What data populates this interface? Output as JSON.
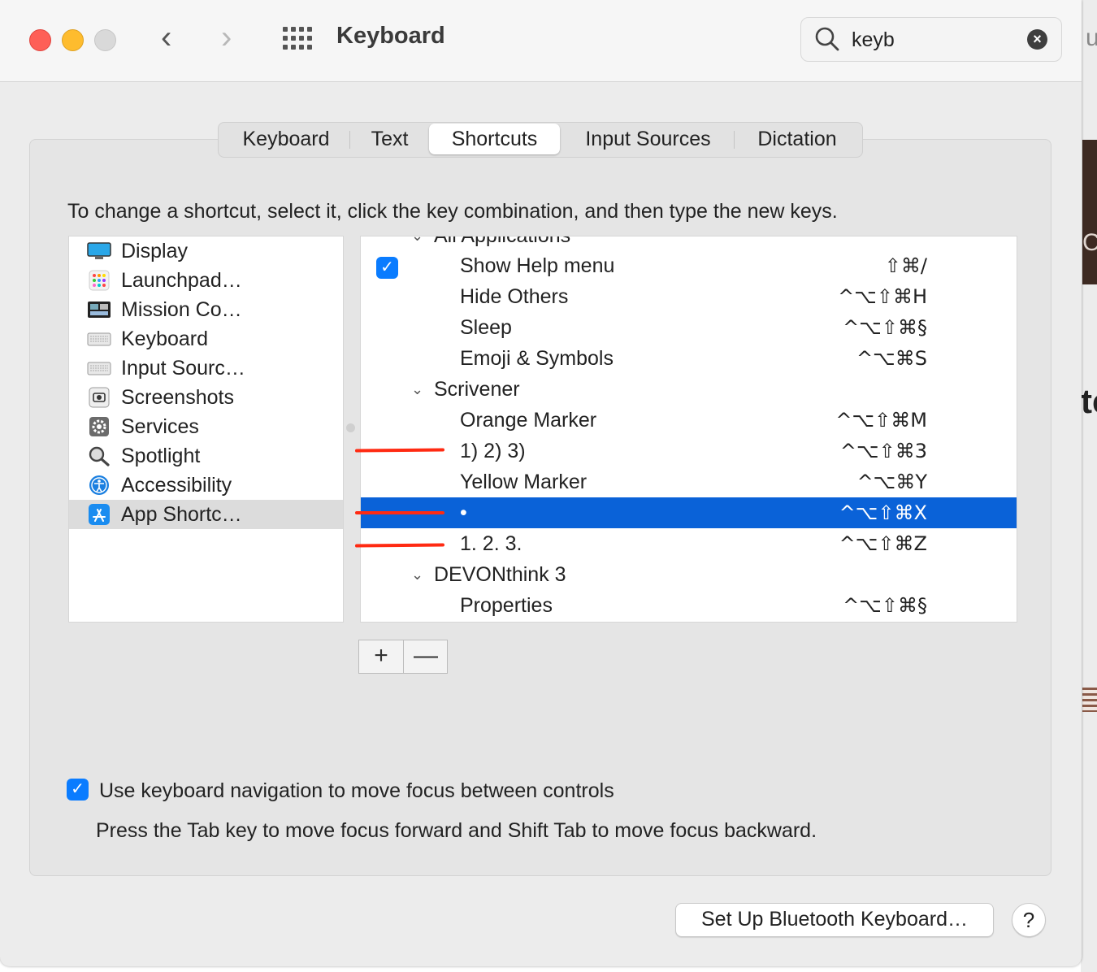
{
  "window": {
    "title": "Keyboard",
    "search": {
      "value": "keyb"
    }
  },
  "tabs": [
    "Keyboard",
    "Text",
    "Shortcuts",
    "Input Sources",
    "Dictation"
  ],
  "selected_tab": "Shortcuts",
  "instruction": "To change a shortcut, select it, click the key combination, and then type the new keys.",
  "sidebar": {
    "items": [
      {
        "label": "Display",
        "icon": "display-icon"
      },
      {
        "label": "Launchpad…",
        "icon": "launchpad-icon"
      },
      {
        "label": "Mission Co…",
        "icon": "mission-control-icon"
      },
      {
        "label": "Keyboard",
        "icon": "keyboard-icon"
      },
      {
        "label": "Input Sourc…",
        "icon": "input-sources-icon"
      },
      {
        "label": "Screenshots",
        "icon": "screenshots-icon"
      },
      {
        "label": "Services",
        "icon": "services-gear-icon"
      },
      {
        "label": "Spotlight",
        "icon": "spotlight-magnifier-icon"
      },
      {
        "label": "Accessibility",
        "icon": "accessibility-icon"
      },
      {
        "label": "App Shortc…",
        "icon": "app-store-icon"
      }
    ],
    "selected": "App Shortc…"
  },
  "shortcuts": {
    "partial_group": "All Applications",
    "rows": [
      {
        "name": "Show Help menu",
        "keys": "⇧⌘/",
        "checked": true
      },
      {
        "name": "Hide Others",
        "keys": "^⌥⇧⌘H"
      },
      {
        "name": "Sleep",
        "keys": "^⌥⇧⌘§"
      },
      {
        "name": "Emoji & Symbols",
        "keys": "^⌥⌘S"
      },
      {
        "group": "Scrivener"
      },
      {
        "name": "Orange Marker",
        "keys": "^⌥⇧⌘M"
      },
      {
        "name": "1)  2)  3)",
        "keys": "^⌥⇧⌘3"
      },
      {
        "name": "Yellow Marker",
        "keys": "^⌥⌘Y"
      },
      {
        "name": "•",
        "keys": "^⌥⇧⌘X",
        "selected": true
      },
      {
        "name": "1.  2.  3.",
        "keys": "^⌥⇧⌘Z"
      },
      {
        "group": "DEVONthink 3"
      },
      {
        "name": "Properties",
        "keys": "^⌥⇧⌘§"
      }
    ]
  },
  "buttons": {
    "add": "+",
    "remove": "—"
  },
  "keyboard_navigation": {
    "label": "Use keyboard navigation to move focus between controls",
    "checked": true,
    "hint": "Press the Tab key to move focus forward and Shift Tab to move focus backward."
  },
  "bluetooth_button": "Set Up Bluetooth Keyboard…",
  "help_button": "?",
  "colors": {
    "selection": "#0a62d8",
    "checkbox": "#0a7cff",
    "annotation": "#ff2a12"
  }
}
